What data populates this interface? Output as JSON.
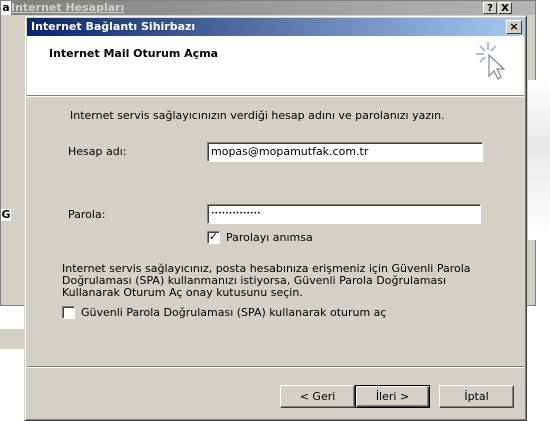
{
  "background_window": {
    "title": "Internet Hesapları",
    "title_prefix": "a",
    "help_label": "?",
    "close_label": "X",
    "side_letter": "G"
  },
  "dialog": {
    "title": "Internet Bağlantı Sihirbazı",
    "close_label": "×",
    "header_title": "Internet Mail Oturum Açma",
    "instruction": "Internet servis sağlayıcınızın verdiği hesap adını ve parolanızı yazın.",
    "account_label": "Hesap adı:",
    "account_value": "mopas@mopamutfak.com.tr",
    "password_label": "Parola:",
    "password_value": "••••••••••••••",
    "remember_label": "Parolayı anımsa",
    "remember_checked": true,
    "spa_text": "Internet servis sağlayıcınız, posta hesabınıza erişmeniz için Güvenli Parola Doğrulaması (SPA) kullanmanızı istiyorsa, Güvenli Parola Doğrulaması Kullanarak Oturum Aç onay kutusunu seçin.",
    "spa_checkbox_label": "Güvenli Parola Doğrulaması (SPA) kullanarak oturum aç",
    "spa_checked": false
  },
  "buttons": {
    "back": "< Geri",
    "next": "İleri >",
    "cancel": "İptal"
  },
  "colors": {
    "titlebar_start": "#0a246a",
    "titlebar_end": "#a6caf0",
    "face": "#d4d0c8"
  }
}
